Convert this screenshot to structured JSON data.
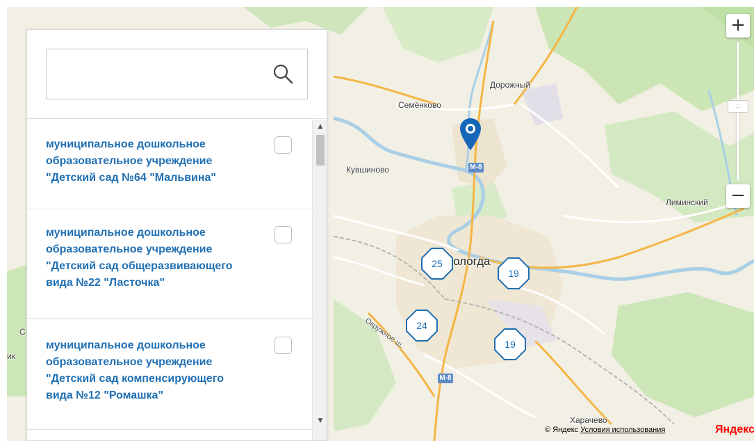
{
  "map": {
    "places": [
      {
        "id": "dorozhny",
        "label": "Дорожный"
      },
      {
        "id": "semenkovo",
        "label": "Семёнково"
      },
      {
        "id": "kuvshinovo",
        "label": "Кувшиново"
      },
      {
        "id": "liminsky",
        "label": "Лиминский"
      },
      {
        "id": "vologda",
        "label": "ологда"
      },
      {
        "id": "kharachevo",
        "label": "Харачево"
      },
      {
        "id": "edge_c",
        "label": "С"
      },
      {
        "id": "edge_ik",
        "label": "ик"
      }
    ],
    "road_label": "Окружное ш.",
    "highway_shields": [
      "М-8",
      "М-8"
    ],
    "clusters": [
      {
        "id": "c1",
        "count": "25"
      },
      {
        "id": "c2",
        "count": "19"
      },
      {
        "id": "c3",
        "count": "24"
      },
      {
        "id": "c4",
        "count": "19"
      }
    ],
    "colors": {
      "cluster_border": "#1f6fb2",
      "marker": "#1565b8",
      "water": "#a9cfe6",
      "forest": "#cde6b8",
      "road_major": "#f5b544"
    }
  },
  "zoom": {
    "plus": "+",
    "minus": "−",
    "thumb": ":::"
  },
  "panel": {
    "search": {
      "value": "",
      "placeholder": ""
    },
    "items": [
      {
        "lines": [
          "муниципальное дошкольное",
          "образовательное учреждение",
          "\"Детский сад №64 \"Мальвина\""
        ],
        "checked": false
      },
      {
        "lines": [
          "муниципальное дошкольное",
          "образовательное учреждение",
          "\"Детский сад общеразвивающего",
          "вида №22 \"Ласточка\""
        ],
        "checked": false
      },
      {
        "lines": [
          "муниципальное дошкольное",
          "образовательное учреждение",
          "\"Детский сад компенсирующего",
          "вида №12 \"Ромашка\""
        ],
        "checked": false
      }
    ],
    "scroll_up": "▲",
    "scroll_down": "▼"
  },
  "footer": {
    "copyright": "© Яндекс",
    "terms_link": "Условия использования",
    "logo": "Яндекс"
  }
}
